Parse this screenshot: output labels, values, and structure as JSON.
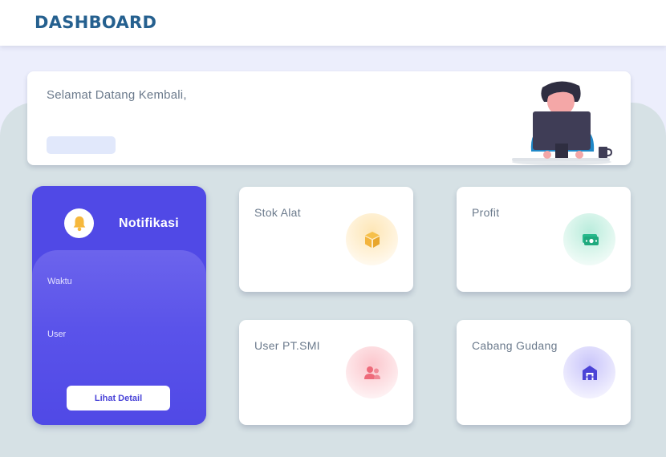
{
  "header": {
    "title": "DASHBOARD"
  },
  "welcome": {
    "greeting": "Selamat Datang Kembali,"
  },
  "notification": {
    "title": "Notifikasi",
    "time_label": "Waktu",
    "user_label": "User",
    "button_label": "Lihat Detail"
  },
  "cards": [
    {
      "label": "Stok Alat",
      "icon": "box-icon",
      "color": "#f3b43c"
    },
    {
      "label": "Profit",
      "icon": "money-icon",
      "color": "#28b98c"
    },
    {
      "label": "User PT.SMI",
      "icon": "users-icon",
      "color": "#ee6a7a"
    },
    {
      "label": "Cabang Gudang",
      "icon": "warehouse-icon",
      "color": "#4b43d6"
    }
  ],
  "colors": {
    "brand": "#25608f",
    "notification_bg": "#5049e6",
    "background": "#d6e1e5"
  }
}
